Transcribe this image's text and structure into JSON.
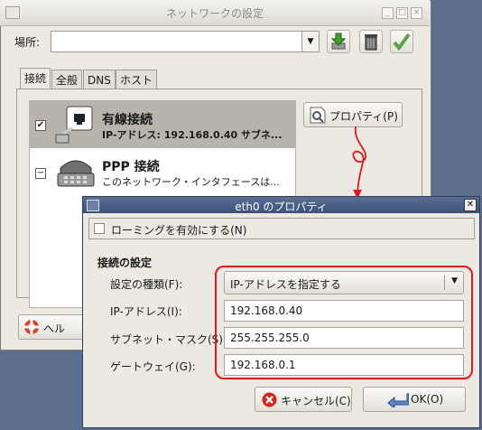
{
  "main_window": {
    "title": "ネットワークの設定",
    "location_label": "場所:",
    "location_value": "",
    "tabs": [
      "接続",
      "全般",
      "DNS",
      "ホスト"
    ],
    "connections": [
      {
        "title": "有線接続",
        "subtitle": "IP-アドレス: 192.168.0.40 サブネ...",
        "checked": true,
        "icon": "ethernet-icon"
      },
      {
        "title": "PPP 接続",
        "subtitle": "このネットワーク・インタフェースは...",
        "checked": false,
        "icon": "modem-icon"
      }
    ],
    "properties_button": "プロパティ(P)",
    "help_button": "ヘル"
  },
  "dialog": {
    "title": "eth0 のプロパティ",
    "roaming_label": "ローミングを有効にする(N)",
    "section_title": "接続の設定",
    "config_type_label": "設定の種類(F):",
    "config_type_value": "IP-アドレスを指定する",
    "ip_label": "IP-アドレス(I):",
    "ip_value": "192.168.0.40",
    "subnet_label": "サブネット・マスク(S):",
    "subnet_value": "255.255.255.0",
    "gateway_label": "ゲートウェイ(G):",
    "gateway_value": "192.168.0.1",
    "cancel_button": "キャンセル(C)",
    "ok_button": "OK(O)"
  },
  "colors": {
    "highlight": "#e3171b",
    "selected_row": "#b7b4ad",
    "dialog_titlebar": "#4a5d85"
  }
}
